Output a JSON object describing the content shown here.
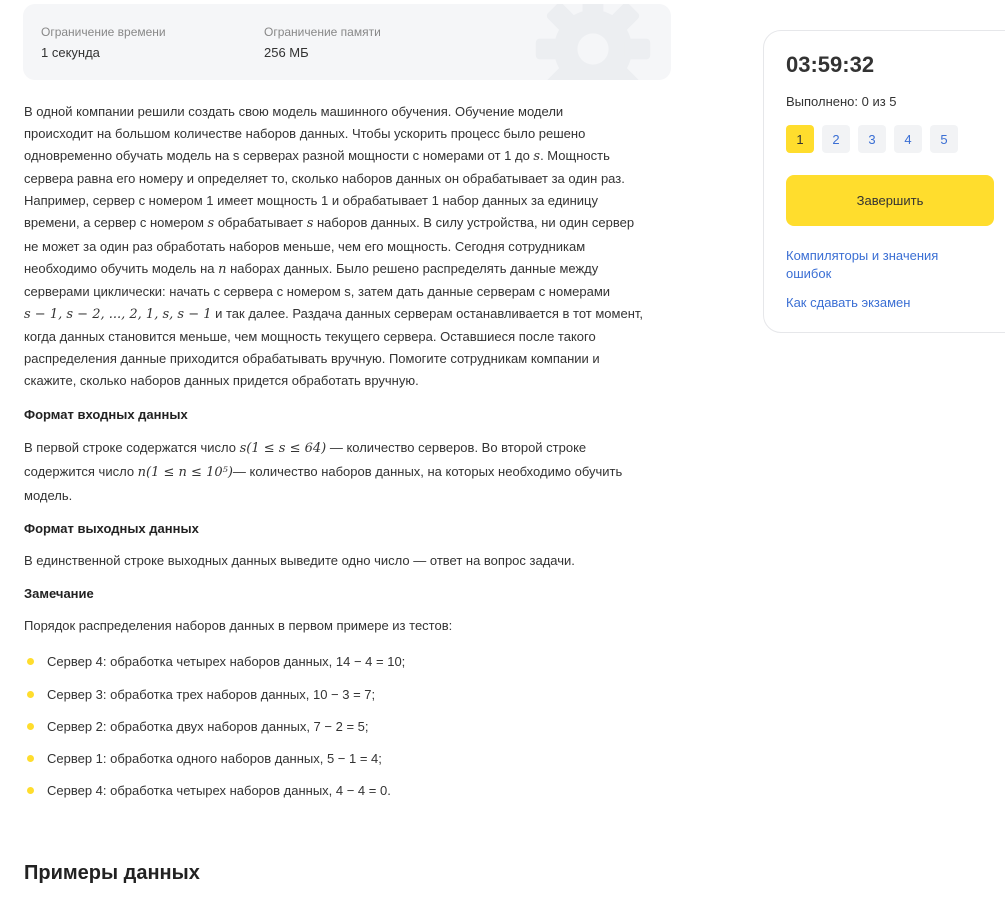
{
  "limits": {
    "time_label": "Ограничение времени",
    "time_value": "1 секунда",
    "memory_label": "Ограничение памяти",
    "memory_value": "256 МБ"
  },
  "statement": {
    "p1": [
      "В одной компании решили создать свою модель машинного обучения. Обучение модели",
      "происходит на большом количестве наборов данных. Чтобы ускорить процесс было решено",
      "одновременно обучать модель на s серверах разной мощности с номерами от 1 до |s|. Мощность",
      "сервера равна его номеру и определяет то, сколько наборов данных он обрабатывает за один раз.",
      "Например, сервер с номером 1 имеет мощность 1 и обрабатывает 1 набор данных за единицу",
      "времени, а сервер с номером |s| обрабатывает |s| наборов данных. В силу устройства, ни один сервер",
      "не может за один раз обработать наборов меньше, чем его мощность. Сегодня сотрудникам",
      "необходимо обучить модель на |n| наборах данных. Было решено распределять данные между",
      "серверами циклически: начать с сервера с номером s, затем дать данные серверам с номерами",
      "|s − 1, s − 2, ..., 2, 1, s, s − 1| и так далее. Раздача данных серверам останавливается в тот момент,",
      "когда данных становится меньше, чем мощность текущего сервера. Оставшиеся после такого",
      "распределения данные приходится обрабатывать вручную. Помогите сотрудникам компании и",
      "скажите, сколько наборов данных придется обработать вручную."
    ],
    "input_heading": "Формат входных данных",
    "input_text": [
      "В первой строке содержатся число |s(1 ≤ s ≤ 64)| — количество серверов. Во второй строке",
      "содержится число |n(1 ≤ n ≤ 10⁵)|— количество наборов данных, на которых необходимо обучить",
      "модель."
    ],
    "output_heading": "Формат выходных данных",
    "output_text": "В единственной строке выходных данных выведите одно число — ответ на вопрос задачи.",
    "note_heading": "Замечание",
    "note_text": "Порядок распределения наборов данных в первом примере из тестов:",
    "note_items": [
      "Сервер 4: обработка четырех наборов данных, 14 − 4 = 10;",
      "Сервер 3: обработка трех наборов данных, 10 − 3 = 7;",
      "Сервер 2: обработка двух наборов данных, 7 − 2 = 5;",
      "Сервер 1: обработка одного наборов данных, 5 − 1 = 4;",
      "Сервер 4: обработка четырех наборов данных, 4 − 4 = 0."
    ],
    "examples_title": "Примеры данных"
  },
  "sidebar": {
    "timer": "03:59:32",
    "progress": "Выполнено: 0 из 5",
    "tasks": [
      "1",
      "2",
      "3",
      "4",
      "5"
    ],
    "active_task": "1",
    "finish_label": "Завершить",
    "link_compilers": "Компиляторы и значения ошибок",
    "link_exam": "Как сдавать экзамен"
  },
  "colors": {
    "accent": "#ffdd2d",
    "link": "#3b6fd4",
    "card_bg": "#f5f6f8"
  },
  "icons": {
    "decoration": "gear-icon"
  }
}
